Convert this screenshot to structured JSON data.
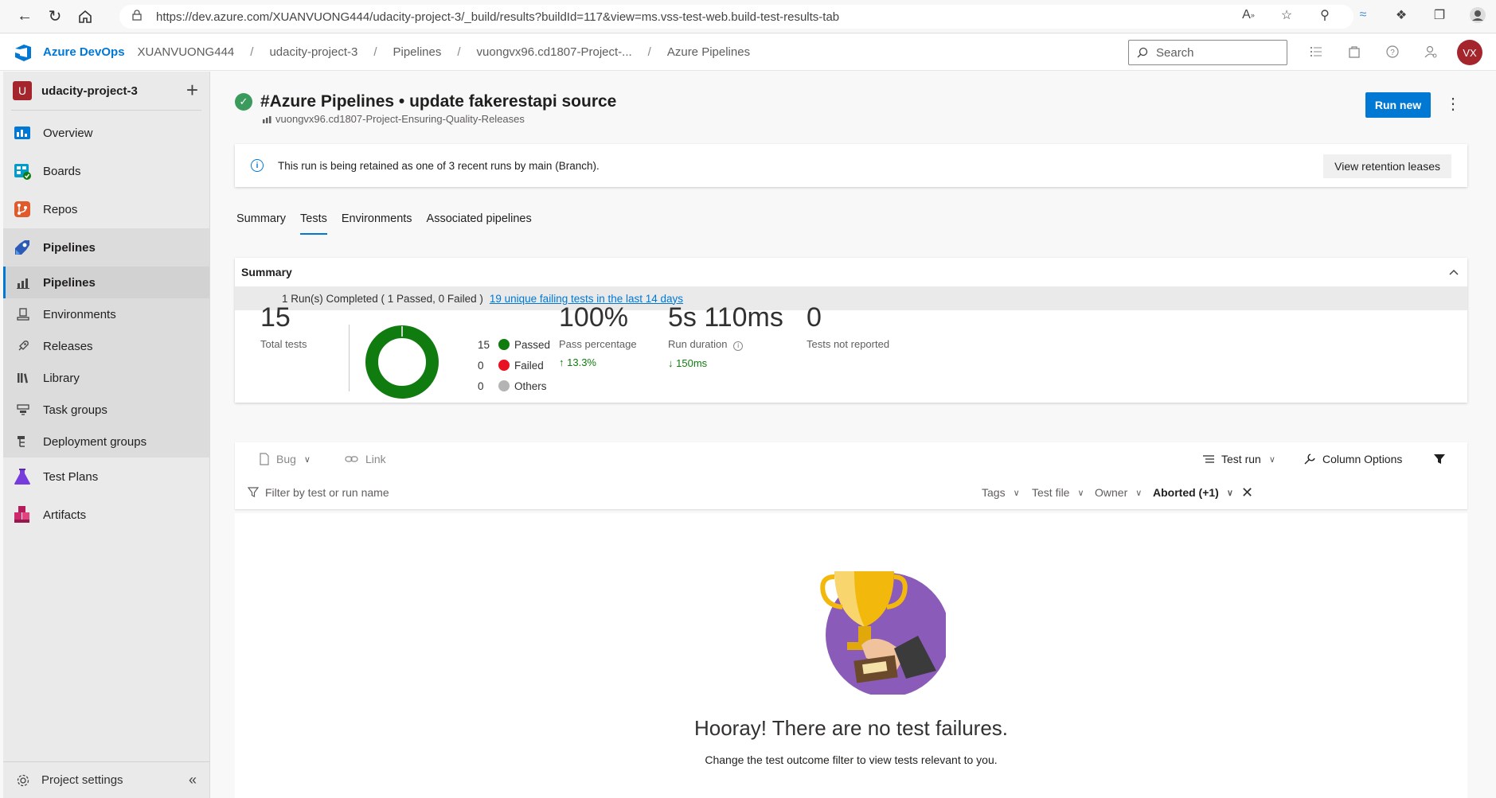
{
  "browser": {
    "url": "https://dev.azure.com/XUANVUONG444/udacity-project-3/_build/results?buildId=117&view=ms.vss-test-web.build-test-results-tab"
  },
  "header": {
    "brand": "Azure DevOps",
    "breadcrumbs": [
      "XUANVUONG444",
      "udacity-project-3",
      "Pipelines",
      "vuongvx96.cd1807-Project-...",
      "Azure Pipelines"
    ],
    "search_placeholder": "Search",
    "avatar_initials": "VX"
  },
  "sidebar": {
    "project_initial": "U",
    "project_name": "udacity-project-3",
    "items": [
      {
        "label": "Overview",
        "icon": "overview-icon"
      },
      {
        "label": "Boards",
        "icon": "boards-icon"
      },
      {
        "label": "Repos",
        "icon": "repos-icon"
      },
      {
        "label": "Pipelines",
        "icon": "pipelines-icon"
      }
    ],
    "sub_items": [
      {
        "label": "Pipelines",
        "icon": "pipelines-sub-icon"
      },
      {
        "label": "Environments",
        "icon": "environments-icon"
      },
      {
        "label": "Releases",
        "icon": "releases-icon"
      },
      {
        "label": "Library",
        "icon": "library-icon"
      },
      {
        "label": "Task groups",
        "icon": "task-groups-icon"
      },
      {
        "label": "Deployment groups",
        "icon": "deployment-groups-icon"
      }
    ],
    "more_items": [
      {
        "label": "Test Plans",
        "icon": "test-plans-icon"
      },
      {
        "label": "Artifacts",
        "icon": "artifacts-icon"
      }
    ],
    "settings_label": "Project settings"
  },
  "run": {
    "title": "#Azure Pipelines • update fakerestapi source",
    "pipeline": "vuongvx96.cd1807-Project-Ensuring-Quality-Releases",
    "run_new_label": "Run new"
  },
  "banner": {
    "text": "This run is being retained as one of 3 recent runs by main (Branch).",
    "button": "View retention leases"
  },
  "tabs": [
    "Summary",
    "Tests",
    "Environments",
    "Associated pipelines"
  ],
  "summary": {
    "heading": "Summary",
    "runs_text": "1 Run(s) Completed ( 1 Passed, 0 Failed )",
    "failing_link": "19 unique failing tests in the last 14 days",
    "total_tests": "15",
    "total_tests_label": "Total tests",
    "legend": [
      {
        "count": "15",
        "label": "Passed",
        "color": "#107c10"
      },
      {
        "count": "0",
        "label": "Failed",
        "color": "#e81123"
      },
      {
        "count": "0",
        "label": "Others",
        "color": "#b4b4b4"
      }
    ],
    "pass_percentage": "100%",
    "pass_percentage_label": "Pass percentage",
    "pass_delta": "13.3%",
    "run_duration": "5s 110ms",
    "run_duration_label": "Run duration",
    "run_duration_delta": "150ms",
    "not_reported": "0",
    "not_reported_label": "Tests not reported"
  },
  "toolbar": {
    "bug": "Bug",
    "link": "Link",
    "test_run": "Test run",
    "column_options": "Column Options",
    "filter_placeholder": "Filter by test or run name",
    "tags": "Tags",
    "test_file": "Test file",
    "owner": "Owner",
    "outcome": "Aborted (+1)"
  },
  "empty": {
    "title": "Hooray! There are no test failures.",
    "hint": "Change the test outcome filter to view tests relevant to you."
  }
}
